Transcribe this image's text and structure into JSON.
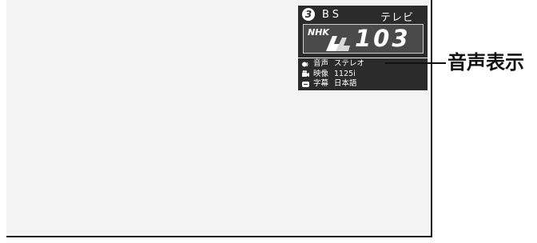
{
  "band": {
    "number": "3",
    "name": "BS",
    "type": "テレビ"
  },
  "channel": {
    "logo_text": "NHK",
    "number": "103"
  },
  "info": [
    {
      "icon": "speaker-icon",
      "label": "音声",
      "value": "ステレオ"
    },
    {
      "icon": "camera-icon",
      "label": "映像",
      "value": "1125i"
    },
    {
      "icon": "subtitle-icon",
      "label": "字幕",
      "value": "日本語"
    }
  ],
  "callout": {
    "text": "音声表示"
  },
  "colors": {
    "banner_bg": "#2b2b2b",
    "screen_bg": "#f4f4f4",
    "text": "#ffffff"
  }
}
